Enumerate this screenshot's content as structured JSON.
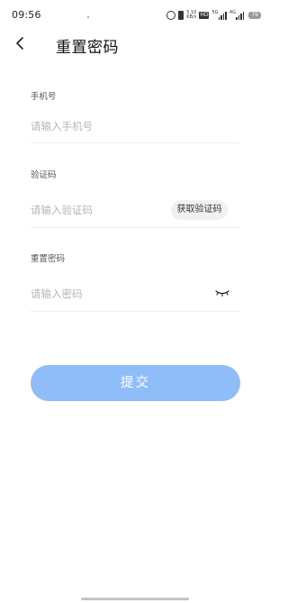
{
  "status_bar": {
    "time": "09:56",
    "net_speed_value": "5.10",
    "net_speed_unit": "KB/s",
    "hd_label": "HD",
    "signal_1_label": "5G",
    "signal_2_label": "4G",
    "battery": "79"
  },
  "header": {
    "title": "重置密码"
  },
  "form": {
    "phone": {
      "label": "手机号",
      "placeholder": "请输入手机号"
    },
    "code": {
      "label": "验证码",
      "placeholder": "请输入验证码",
      "get_code_label": "获取验证码"
    },
    "password": {
      "label": "重置密码",
      "placeholder": "请输入密码"
    },
    "submit_label": "提交"
  }
}
